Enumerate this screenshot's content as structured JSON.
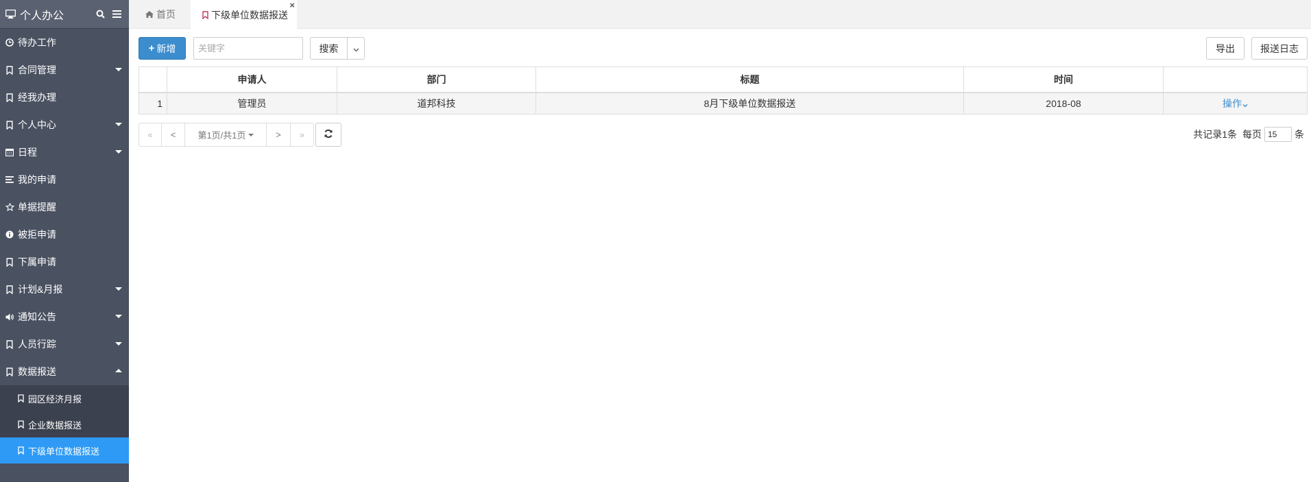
{
  "sidebar": {
    "title": "个人办公",
    "items": [
      {
        "label": "待办工作",
        "icon": "clock-icon"
      },
      {
        "label": "合同管理",
        "icon": "bookmark-icon",
        "caret": "down"
      },
      {
        "label": "经我办理",
        "icon": "bookmark-icon"
      },
      {
        "label": "个人中心",
        "icon": "bookmark-icon",
        "caret": "down"
      },
      {
        "label": "日程",
        "icon": "calendar-icon",
        "caret": "down"
      },
      {
        "label": "我的申请",
        "icon": "list-icon"
      },
      {
        "label": "单据提醒",
        "icon": "star-icon"
      },
      {
        "label": "被拒申请",
        "icon": "info-icon"
      },
      {
        "label": "下属申请",
        "icon": "bookmark-icon"
      },
      {
        "label": "计划&月报",
        "icon": "bookmark-icon",
        "caret": "down"
      },
      {
        "label": "通知公告",
        "icon": "volume-icon",
        "caret": "down"
      },
      {
        "label": "人员行踪",
        "icon": "bookmark-icon",
        "caret": "down"
      },
      {
        "label": "数据报送",
        "icon": "bookmark-icon",
        "caret": "up"
      }
    ],
    "subitems": [
      {
        "label": "园区经济月报"
      },
      {
        "label": "企业数据报送"
      },
      {
        "label": "下级单位数据报送",
        "active": true
      }
    ]
  },
  "tabs": {
    "home": "首页",
    "active": "下级单位数据报送",
    "close": "×"
  },
  "toolbar": {
    "add_label": "新增",
    "search_placeholder": "关键字",
    "search_label": "搜索",
    "export_label": "导出",
    "log_label": "报送日志"
  },
  "table": {
    "headers": [
      "",
      "申请人",
      "部门",
      "标题",
      "时间",
      ""
    ],
    "rows": [
      {
        "num": "1",
        "applicant": "管理员",
        "dept": "道邦科技",
        "title": "8月下级单位数据报送",
        "time": "2018-08",
        "op": "操作"
      }
    ]
  },
  "pager": {
    "first": "«",
    "prev": "<",
    "page_label": "第1页/共1页",
    "next": ">",
    "last": "»",
    "total_label": "共记录1条",
    "per_page_label": "每页",
    "per_page_value": "15",
    "unit": "条"
  },
  "colors": {
    "sidebar_bg": "#4a5161",
    "active_blue": "#2f9af5",
    "primary": "#3c8dce"
  }
}
